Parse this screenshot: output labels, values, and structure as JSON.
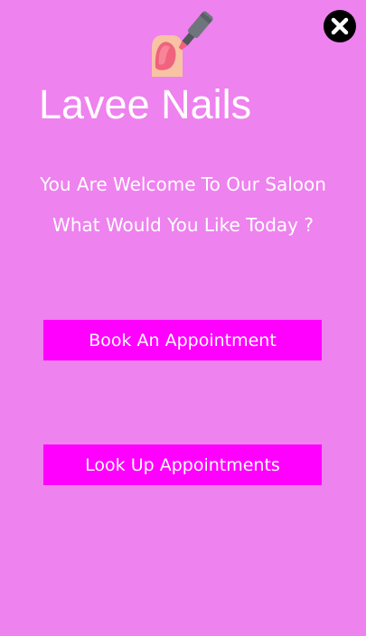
{
  "app": {
    "title": "Lavee Nails",
    "logo_icon": "nail-polish-icon",
    "close_icon": "close-icon"
  },
  "welcome": {
    "line1": "You Are Welcome To Our Saloon",
    "line2": "What Would You Like Today ?"
  },
  "actions": {
    "book_label": "Book An Appointment",
    "lookup_label": "Look Up Appointments"
  },
  "colors": {
    "background": "#EE82EE",
    "button": "#FF00FF",
    "text": "#FFFFFF"
  }
}
